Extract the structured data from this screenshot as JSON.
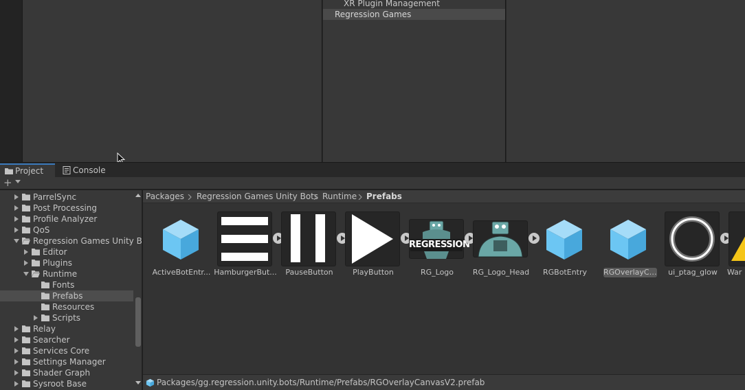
{
  "settings_list": {
    "items": [
      {
        "label": "XR Plugin Management",
        "selected": false
      },
      {
        "label": "Regression Games",
        "selected": true
      }
    ]
  },
  "tabs": [
    {
      "label": "Project",
      "icon": "folder-icon",
      "active": true
    },
    {
      "label": "Console",
      "icon": "console-icon",
      "active": false
    }
  ],
  "toolbar": {
    "create_icon": "plus-icon",
    "create_caret_icon": "chevron-down-icon"
  },
  "tree": {
    "items": [
      {
        "label": "ParrelSync",
        "depth": 0,
        "expanded": false
      },
      {
        "label": "Post Processing",
        "depth": 0,
        "expanded": false
      },
      {
        "label": "Profile Analyzer",
        "depth": 0,
        "expanded": false
      },
      {
        "label": "QoS",
        "depth": 0,
        "expanded": false
      },
      {
        "label": "Regression Games Unity B",
        "depth": 0,
        "expanded": true
      },
      {
        "label": "Editor",
        "depth": 1,
        "expanded": false
      },
      {
        "label": "Plugins",
        "depth": 1,
        "expanded": false
      },
      {
        "label": "Runtime",
        "depth": 1,
        "expanded": true
      },
      {
        "label": "Fonts",
        "depth": 2,
        "leaf": true
      },
      {
        "label": "Prefabs",
        "depth": 2,
        "leaf": true,
        "selected": true
      },
      {
        "label": "Resources",
        "depth": 2,
        "leaf": true
      },
      {
        "label": "Scripts",
        "depth": 2,
        "expanded": false
      },
      {
        "label": "Relay",
        "depth": 0,
        "expanded": false
      },
      {
        "label": "Searcher",
        "depth": 0,
        "expanded": false
      },
      {
        "label": "Services Core",
        "depth": 0,
        "expanded": false
      },
      {
        "label": "Settings Manager",
        "depth": 0,
        "expanded": false
      },
      {
        "label": "Shader Graph",
        "depth": 0,
        "expanded": false
      },
      {
        "label": "Sysroot Base",
        "depth": 0,
        "expanded": false
      }
    ]
  },
  "breadcrumbs": [
    {
      "label": "Packages",
      "bold": false
    },
    {
      "label": "Regression Games Unity Bots",
      "bold": false
    },
    {
      "label": "Runtime",
      "bold": false
    },
    {
      "label": "Prefabs",
      "bold": true
    }
  ],
  "assets": [
    {
      "label": "ActiveBotEntr...",
      "thumb": "cube-icon",
      "expandable": false
    },
    {
      "label": "HamburgerBut...",
      "thumb": "hamburger-icon",
      "expandable": true
    },
    {
      "label": "PauseButton",
      "thumb": "pause-icon",
      "expandable": true
    },
    {
      "label": "PlayButton",
      "thumb": "play-icon",
      "expandable": true
    },
    {
      "label": "RG_Logo",
      "thumb": "regression-logo",
      "logo_text": "REGRESSION",
      "expandable": true
    },
    {
      "label": "RG_Logo_Head",
      "thumb": "robot-head-logo",
      "expandable": true
    },
    {
      "label": "RGBotEntry",
      "thumb": "cube-icon",
      "expandable": false
    },
    {
      "label": "RGOverlayCa...",
      "thumb": "cube-icon",
      "expandable": false,
      "selected": true
    },
    {
      "label": "ui_ptag_glow",
      "thumb": "ring-icon",
      "expandable": true
    },
    {
      "label": "War",
      "thumb": "warning-icon",
      "expandable": false
    }
  ],
  "status": {
    "path": "Packages/gg.regression.unity.bots/Runtime/Prefabs/RGOverlayCanvasV2.prefab",
    "icon": "prefab-icon"
  },
  "colors": {
    "accent": "#3a79bb",
    "cube": "#6cc6f3",
    "cube_light": "#a5dcf8",
    "cube_dark": "#48a8dc",
    "logo": "#6aa7a6"
  }
}
